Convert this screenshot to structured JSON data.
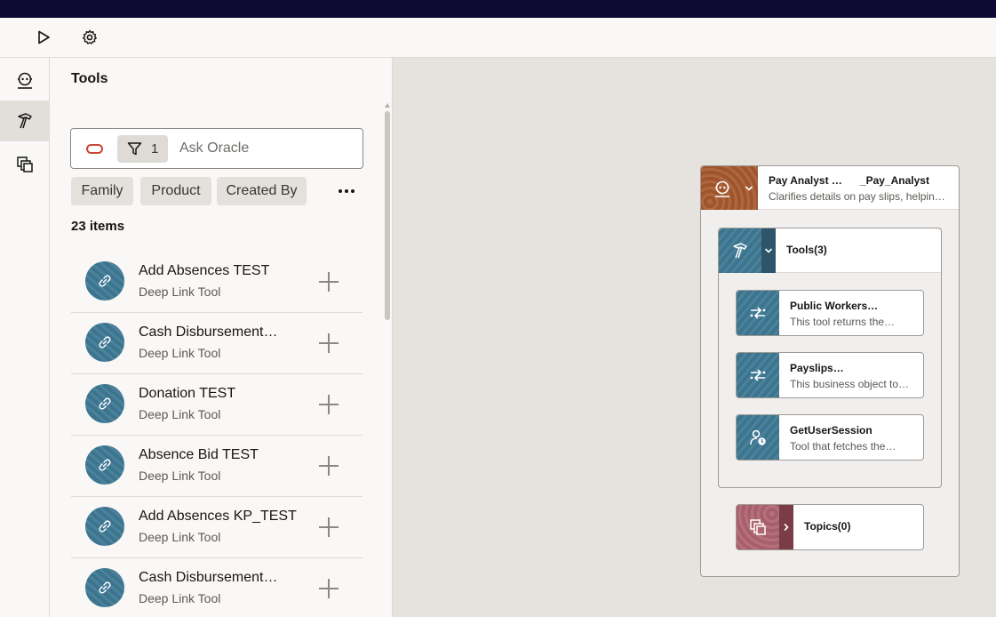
{
  "toolbar": {
    "run_icon": "play-icon",
    "settings_icon": "gear-icon"
  },
  "rail": {
    "items": [
      "agent-icon",
      "hammer-icon",
      "topics-icon"
    ],
    "active": "hammer-icon"
  },
  "panel": {
    "title": "Tools",
    "search": {
      "placeholder": "Ask Oracle",
      "filter_count": "1"
    },
    "chips": [
      "Family",
      "Product",
      "Created By"
    ],
    "count": "23 items",
    "items": [
      {
        "title": "Add Absences TEST",
        "subtitle": "Deep Link Tool"
      },
      {
        "title": "Cash Disbursement…",
        "subtitle": "Deep Link Tool"
      },
      {
        "title": "Donation TEST",
        "subtitle": "Deep Link Tool"
      },
      {
        "title": "Absence Bid TEST",
        "subtitle": "Deep Link Tool"
      },
      {
        "title": "Add Absences KP_TEST",
        "subtitle": "Deep Link Tool"
      },
      {
        "title": "Cash Disbursement…",
        "subtitle": "Deep Link Tool"
      }
    ]
  },
  "canvas": {
    "agent": {
      "name_part1": "Pay Analyst …",
      "name_part2": "_Pay_Analyst",
      "description": "Clarifies details on pay slips, helpin…"
    },
    "tools_group": {
      "label": "Tools(3)",
      "tools": [
        {
          "name": "Public Workers…",
          "description": "This tool returns the…",
          "icon": "business-object-icon"
        },
        {
          "name": "Payslips…",
          "description": "This business object to…",
          "icon": "business-object-icon"
        },
        {
          "name": "GetUserSession",
          "description": "Tool that fetches the…",
          "icon": "user-session-icon"
        }
      ]
    },
    "topics": {
      "label": "Topics(0)"
    }
  },
  "colors": {
    "topbar": "#0d0a33",
    "agent_accent": "#a85a2f",
    "tool_accent": "#3f7a96",
    "topic_accent": "#b06571",
    "oracle_red": "#c74634"
  }
}
